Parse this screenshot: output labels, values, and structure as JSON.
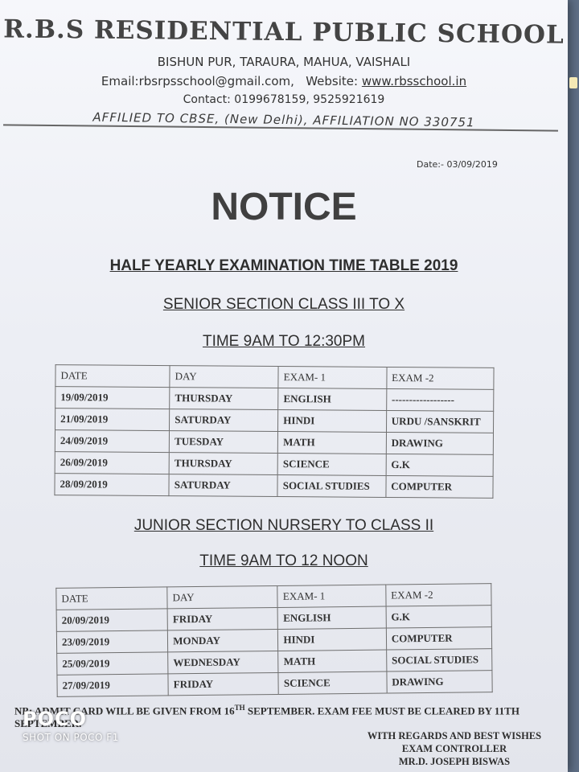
{
  "school": {
    "name": "R.B.S RESIDENTIAL PUBLIC SCHOOL",
    "address": "BISHUN PUR, TARAURA, MAHUA, VAISHALI",
    "email_text": "Email:rbsrpsschool@gmail.com,",
    "website_label": "Website:",
    "website": "www.rbsschool.in",
    "contact": "Contact: 0199678159, 9525921619",
    "affiliation": "AFFILIED TO CBSE, (New Delhi), AFFILIATION NO 330751"
  },
  "date": "Date:- 03/09/2019",
  "notice_title": "NOTICE",
  "exam_heading": "HALF YEARLY EXAMINATION TIME TABLE 2019",
  "senior": {
    "heading": "SENIOR SECTION  CLASS III TO X",
    "time": "TIME 9AM TO 12:30PM",
    "columns": [
      "DATE",
      "DAY",
      "EXAM- 1",
      "EXAM -2"
    ],
    "rows": [
      [
        "19/09/2019",
        "THURSDAY",
        "ENGLISH",
        "------------------"
      ],
      [
        "21/09/2019",
        "SATURDAY",
        "HINDI",
        "URDU /SANSKRIT"
      ],
      [
        "24/09/2019",
        "TUESDAY",
        "MATH",
        "DRAWING"
      ],
      [
        "26/09/2019",
        "THURSDAY",
        "SCIENCE",
        "G.K"
      ],
      [
        "28/09/2019",
        "SATURDAY",
        "SOCIAL STUDIES",
        "COMPUTER"
      ]
    ]
  },
  "junior": {
    "heading": "JUNIOR SECTION   NURSERY TO CLASS II",
    "time": "TIME 9AM TO 12 NOON",
    "columns": [
      "DATE",
      "DAY",
      "EXAM- 1",
      "EXAM -2"
    ],
    "rows": [
      [
        "20/09/2019",
        "FRIDAY",
        "ENGLISH",
        "G.K"
      ],
      [
        "23/09/2019",
        "MONDAY",
        "HINDI",
        "COMPUTER"
      ],
      [
        "25/09/2019",
        "WEDNESDAY",
        "MATH",
        "SOCIAL STUDIES"
      ],
      [
        "27/09/2019",
        "FRIDAY",
        "SCIENCE",
        "DRAWING"
      ]
    ]
  },
  "footer": {
    "note_start": "NB: ADMIT CARD WILL BE GIVEN FROM 16",
    "note_sup": "TH",
    "note_end": " SEPTEMBER. EXAM FEE MUST BE CLEARED BY 11TH SEPTEMBER.",
    "regards": "WITH REGARDS AND BEST WISHES",
    "role": "EXAM CONTROLLER",
    "name": "MR.D. JOSEPH BISWAS"
  },
  "watermark": {
    "logo": "POCO",
    "caption": "SHOT ON POCO F1"
  },
  "colors": {
    "paper": "#eef0f5",
    "ink": "#333333",
    "background": "#5f6f86"
  }
}
